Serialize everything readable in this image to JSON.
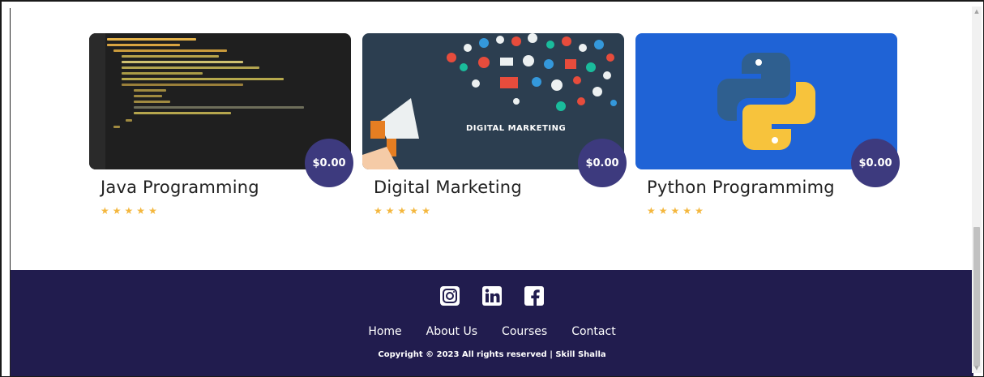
{
  "colors": {
    "footer_bg": "#211c4e",
    "price_badge": "#3d3a7e",
    "star": "#f4b73e",
    "python_bg": "#1f63d6",
    "marketing_bg": "#2c3e50",
    "code_bg": "#1f1f1f"
  },
  "courses": [
    {
      "title": "Java Programming",
      "price": "$0.00",
      "rating": 5,
      "image_icon": "java-code-image"
    },
    {
      "title": "Digital Marketing",
      "price": "$0.00",
      "rating": 5,
      "image_icon": "digital-marketing-image",
      "image_caption": "DIGITAL MARKETING"
    },
    {
      "title": "Python Programmimg",
      "price": "$0.00",
      "rating": 5,
      "image_icon": "python-logo-image"
    }
  ],
  "footer": {
    "social": [
      "instagram-icon",
      "linkedin-icon",
      "facebook-icon"
    ],
    "nav": [
      "Home",
      "About Us",
      "Courses",
      "Contact"
    ],
    "copyright": "Copyright © 2023 All rights reserved | Skill Shalla"
  }
}
